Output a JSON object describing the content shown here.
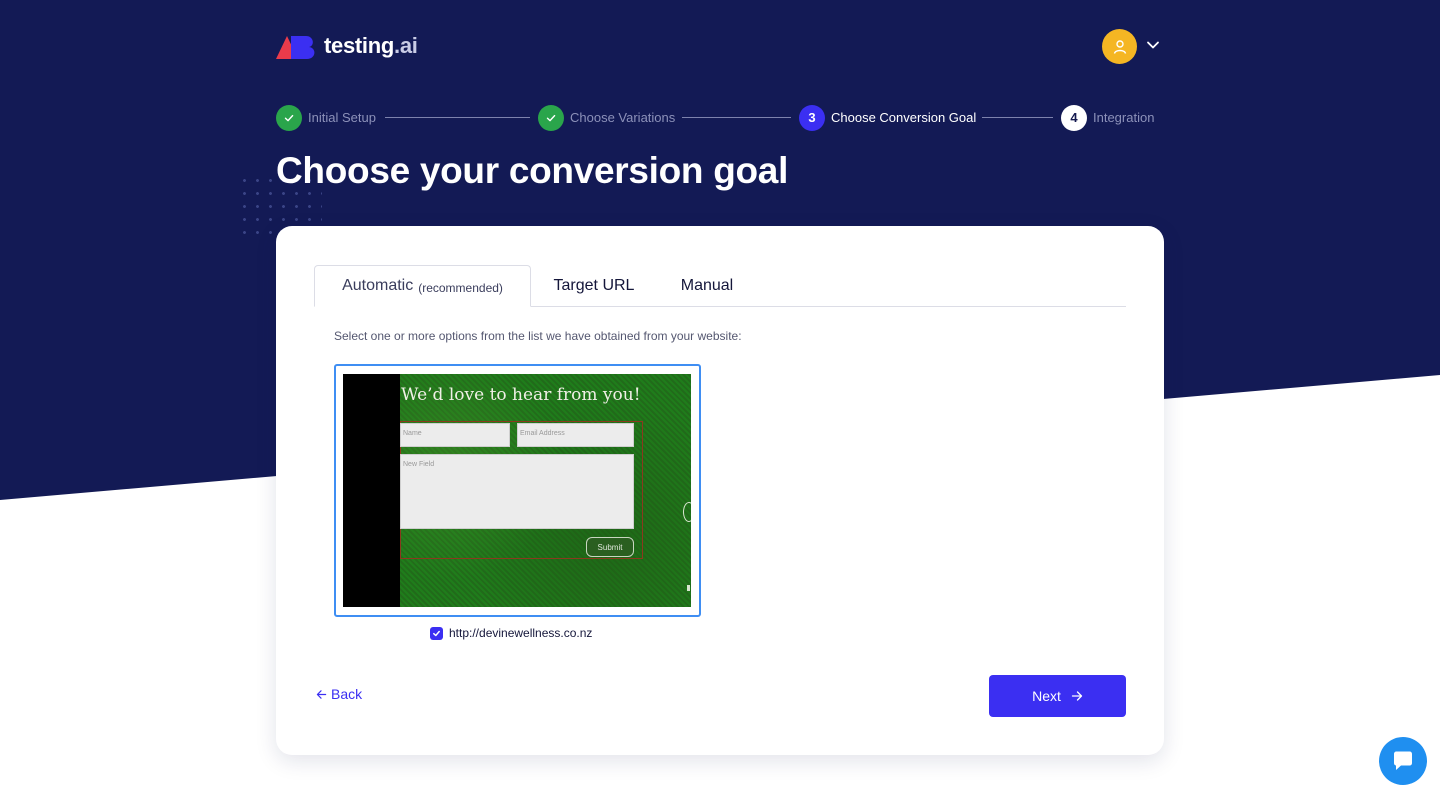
{
  "brand": {
    "name_main": "testing",
    "name_suffix": ".ai",
    "logo_colors": {
      "red": "#ea3b4b",
      "blue": "#3b2ff2"
    }
  },
  "header": {
    "avatar_icon": "user-icon",
    "menu_icon": "chevron-down-icon"
  },
  "stepper": {
    "steps": [
      {
        "number": "1",
        "label": "Initial Setup",
        "state": "done"
      },
      {
        "number": "2",
        "label": "Choose Variations",
        "state": "done"
      },
      {
        "number": "3",
        "label": "Choose Conversion Goal",
        "state": "active"
      },
      {
        "number": "4",
        "label": "Integration",
        "state": "todo"
      }
    ]
  },
  "page": {
    "title": "Choose your conversion goal"
  },
  "tabs": {
    "automatic": "Automatic",
    "automatic_sub": "(recommended)",
    "target_url": "Target URL",
    "manual": "Manual",
    "selected": "automatic"
  },
  "main": {
    "instructions": "Select one or more options from the list we have obtained from your website:",
    "options": [
      {
        "preview": {
          "heading": "We’d love to hear from you!",
          "name_placeholder": "Name",
          "email_placeholder": "Email Address",
          "message_placeholder": "New Field",
          "submit_label": "Submit"
        },
        "url": "http://devinewellness.co.nz",
        "checked": true
      }
    ]
  },
  "footer": {
    "back_label": "Back",
    "next_label": "Next"
  },
  "colors": {
    "navy": "#131a55",
    "primary": "#3b2ff2",
    "success": "#2aa54b",
    "avatar": "#f5b623",
    "chat": "#1f8ff0"
  },
  "chat": {
    "icon": "chat-bubble-icon"
  }
}
